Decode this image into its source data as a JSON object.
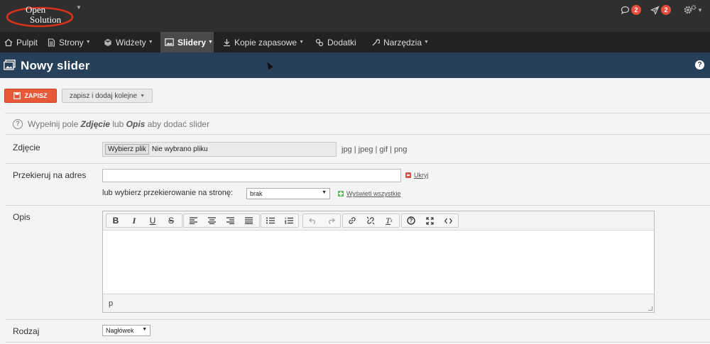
{
  "logo": {
    "line1": "Open",
    "line2": "Solution"
  },
  "top_icons": {
    "comments_count": "2",
    "notifications_count": "2"
  },
  "nav": [
    {
      "label": "Pulpit",
      "icon": "home-icon",
      "caret": false
    },
    {
      "label": "Strony",
      "icon": "file-icon",
      "caret": true
    },
    {
      "label": "Widżety",
      "icon": "cube-icon",
      "caret": true
    },
    {
      "label": "Slidery",
      "icon": "image-icon",
      "caret": true,
      "active": true
    },
    {
      "label": "Kopie zapasowe",
      "icon": "download-icon",
      "caret": true
    },
    {
      "label": "Dodatki",
      "icon": "puzzle-icon",
      "caret": false
    },
    {
      "label": "Narzędzia",
      "icon": "wrench-icon",
      "caret": true
    }
  ],
  "page": {
    "title": "Nowy slider",
    "help": "?"
  },
  "actions": {
    "save": "ZAPISZ",
    "save_add": "zapisz i dodaj kolejne"
  },
  "info": {
    "prefix": "Wypełnij pole ",
    "field1": "Zdjęcie",
    "middle": " lub ",
    "field2": "Opis",
    "suffix": " aby dodać slider"
  },
  "form": {
    "photo_label": "Zdjęcie",
    "file_button": "Wybierz plik",
    "file_status": "Nie wybrano pliku",
    "file_types": "jpg | jpeg | gif | png",
    "redirect_label": "Przekieruj na adres",
    "url_value": "",
    "hide_link": "Ukryj",
    "page_select_label": "lub wybierz przekierowanie na stronę:",
    "page_select_value": "brak",
    "show_all_link": "Wyświetl wszystkie",
    "desc_label": "Opis",
    "editor_path": "p",
    "type_label": "Rodzaj",
    "type_value": "Nagłówek"
  }
}
